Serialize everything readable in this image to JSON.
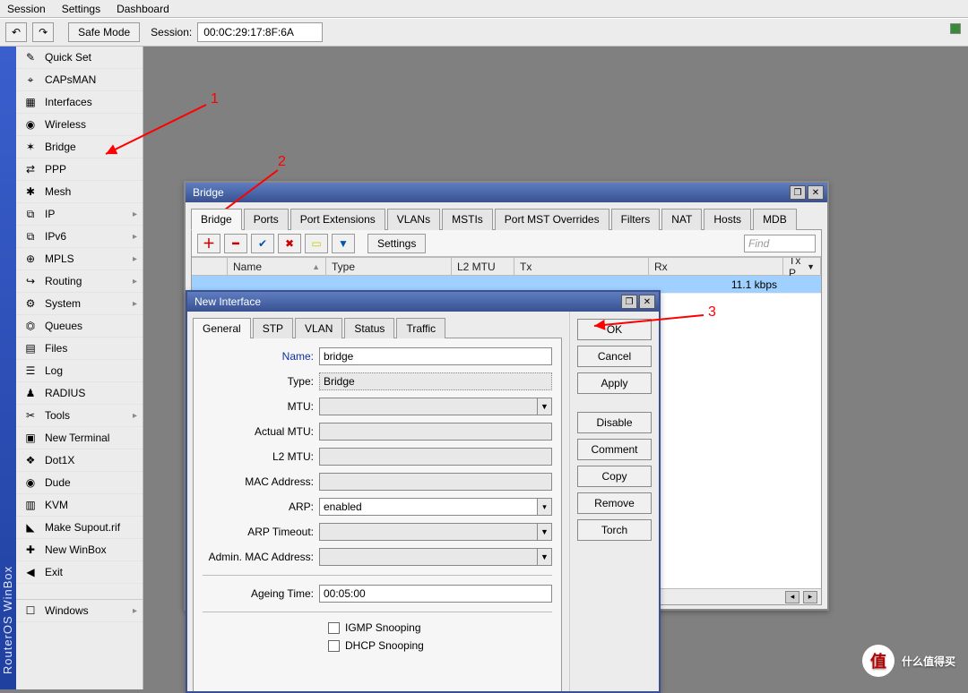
{
  "menubar": {
    "items": [
      "Session",
      "Settings",
      "Dashboard"
    ]
  },
  "toolbar": {
    "undo": "↶",
    "redo": "↷",
    "safe_mode": "Safe Mode",
    "session_label": "Session:",
    "session_value": "00:0C:29:17:8F:6A"
  },
  "leftrail_text": "RouterOS  WinBox",
  "sidebar": {
    "items": [
      {
        "label": "Quick Set",
        "icon": "✎",
        "arrow": false
      },
      {
        "label": "CAPsMAN",
        "icon": "⌖",
        "arrow": false
      },
      {
        "label": "Interfaces",
        "icon": "▦",
        "arrow": false
      },
      {
        "label": "Wireless",
        "icon": "◉",
        "arrow": false
      },
      {
        "label": "Bridge",
        "icon": "✶",
        "arrow": false
      },
      {
        "label": "PPP",
        "icon": "⇄",
        "arrow": false
      },
      {
        "label": "Mesh",
        "icon": "✱",
        "arrow": false
      },
      {
        "label": "IP",
        "icon": "⧉",
        "arrow": true
      },
      {
        "label": "IPv6",
        "icon": "⧉",
        "arrow": true
      },
      {
        "label": "MPLS",
        "icon": "⊕",
        "arrow": true
      },
      {
        "label": "Routing",
        "icon": "↪",
        "arrow": true
      },
      {
        "label": "System",
        "icon": "⚙",
        "arrow": true
      },
      {
        "label": "Queues",
        "icon": "⏣",
        "arrow": false
      },
      {
        "label": "Files",
        "icon": "▤",
        "arrow": false
      },
      {
        "label": "Log",
        "icon": "☰",
        "arrow": false
      },
      {
        "label": "RADIUS",
        "icon": "♟",
        "arrow": false
      },
      {
        "label": "Tools",
        "icon": "✂",
        "arrow": true
      },
      {
        "label": "New Terminal",
        "icon": "▣",
        "arrow": false
      },
      {
        "label": "Dot1X",
        "icon": "❖",
        "arrow": false
      },
      {
        "label": "Dude",
        "icon": "◉",
        "arrow": false
      },
      {
        "label": "KVM",
        "icon": "▥",
        "arrow": false
      },
      {
        "label": "Make Supout.rif",
        "icon": "◣",
        "arrow": false
      },
      {
        "label": "New WinBox",
        "icon": "✚",
        "arrow": false
      },
      {
        "label": "Exit",
        "icon": "◀",
        "arrow": false
      }
    ],
    "bottom": [
      {
        "label": "Windows",
        "icon": "☐",
        "arrow": true
      }
    ]
  },
  "bridge_win": {
    "title": "Bridge",
    "tabs": [
      "Bridge",
      "Ports",
      "Port Extensions",
      "VLANs",
      "MSTIs",
      "Port MST Overrides",
      "Filters",
      "NAT",
      "Hosts",
      "MDB"
    ],
    "settings_btn": "Settings",
    "find_placeholder": "Find",
    "columns": [
      "",
      "Name",
      "Type",
      "L2 MTU",
      "Tx",
      "Rx",
      "Tx P"
    ],
    "row_rx": "11.1 kbps"
  },
  "newif_win": {
    "title": "New Interface",
    "tabs": [
      "General",
      "STP",
      "VLAN",
      "Status",
      "Traffic"
    ],
    "buttons": [
      "OK",
      "Cancel",
      "Apply"
    ],
    "buttons2": [
      "Disable",
      "Comment",
      "Copy",
      "Remove",
      "Torch"
    ],
    "fields": {
      "name_label": "Name:",
      "name_value": "bridge",
      "type_label": "Type:",
      "type_value": "Bridge",
      "mtu_label": "MTU:",
      "actual_mtu_label": "Actual MTU:",
      "l2mtu_label": "L2 MTU:",
      "mac_label": "MAC Address:",
      "arp_label": "ARP:",
      "arp_value": "enabled",
      "arp_to_label": "ARP Timeout:",
      "admin_mac_label": "Admin. MAC Address:",
      "ageing_label": "Ageing Time:",
      "ageing_value": "00:05:00",
      "igmp_label": "IGMP Snooping",
      "dhcp_label": "DHCP Snooping"
    }
  },
  "annotations": {
    "a1": "1",
    "a2": "2",
    "a3": "3"
  },
  "watermark": {
    "icon": "值",
    "text": "什么值得买"
  }
}
